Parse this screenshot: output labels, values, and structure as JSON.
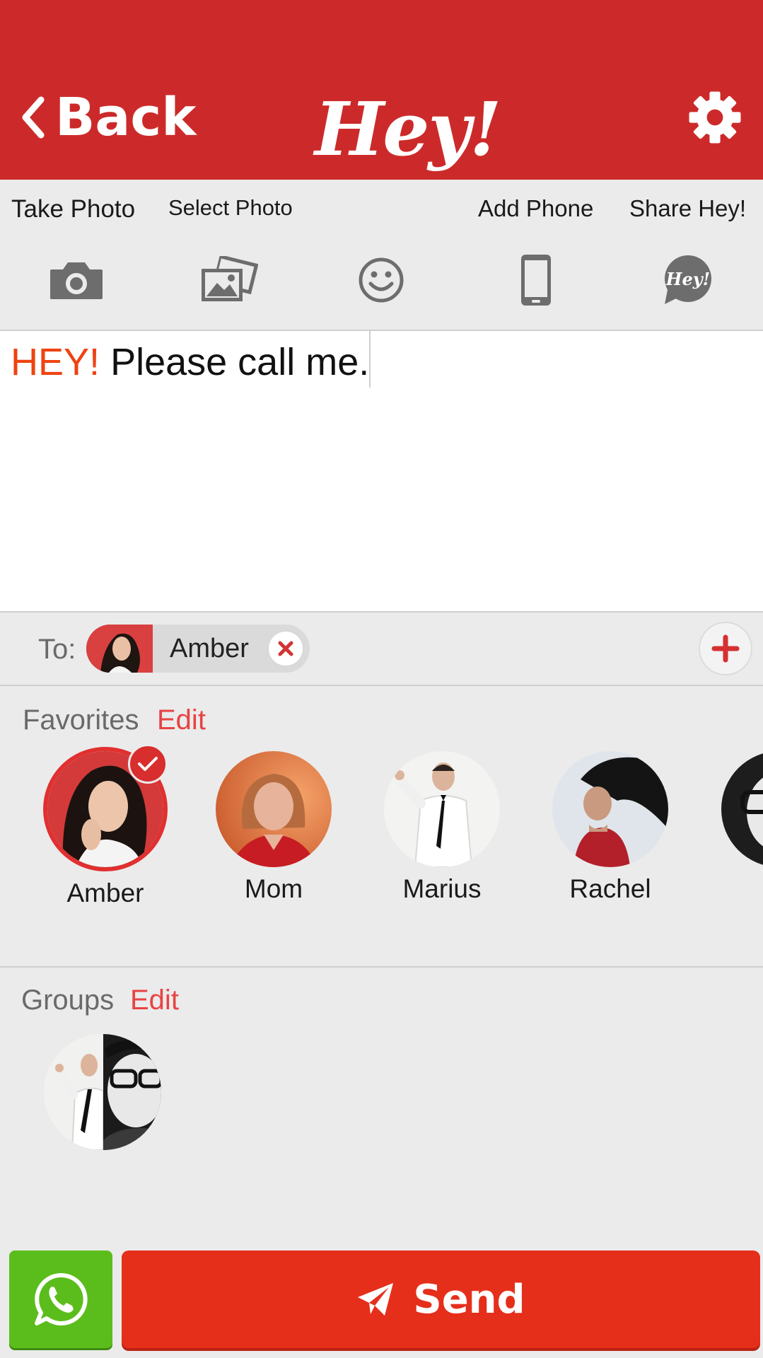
{
  "header": {
    "back_label": "Back",
    "logo_text": "Hey!",
    "accent_color": "#cc2a2a"
  },
  "toolbar": {
    "labels": [
      "Take Photo",
      "Select Photo",
      "Add Phone",
      "Share Hey!"
    ],
    "icons": [
      "camera-icon",
      "photo-gallery-icon",
      "smiley-icon",
      "phone-icon",
      "hey-bubble-icon"
    ],
    "hey_icon_text": "Hey!"
  },
  "message": {
    "hey_prefix": "HEY!",
    "body": "Please call me."
  },
  "recipients": {
    "to_label": "To:",
    "chips": [
      {
        "name": "Amber"
      }
    ]
  },
  "favorites": {
    "title": "Favorites",
    "edit_label": "Edit",
    "contacts": [
      {
        "name": "Amber",
        "selected": true
      },
      {
        "name": "Mom",
        "selected": false
      },
      {
        "name": "Marius",
        "selected": false
      },
      {
        "name": "Rachel",
        "selected": false
      }
    ]
  },
  "groups": {
    "title": "Groups",
    "edit_label": "Edit"
  },
  "bottom": {
    "send_label": "Send",
    "whatsapp_color": "#5bbd1c",
    "send_color": "#e52f1b"
  }
}
